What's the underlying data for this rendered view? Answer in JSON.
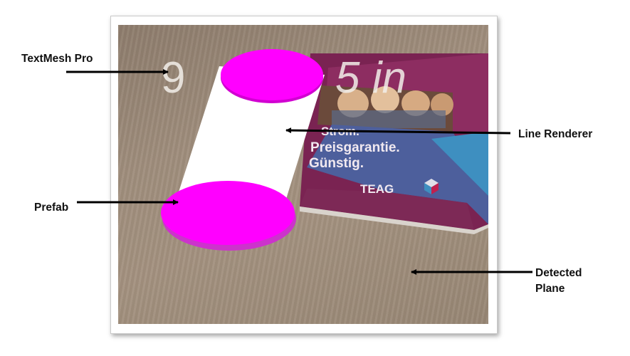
{
  "labels": {
    "textmesh": "TextMesh Pro",
    "line_renderer": "Line Renderer",
    "prefab": "Prefab",
    "detected_plane_line1": "Detected",
    "detected_plane_line2": "Plane"
  },
  "scene": {
    "overlay_text": "9",
    "overlay_text_tail": "5 in",
    "brochure_line1": "Strom.",
    "brochure_line2": "Preisgarantie.",
    "brochure_line3": "Günstig.",
    "brochure_brand": "TEAG"
  },
  "colors": {
    "prefab": "#ff00ff",
    "line_renderer": "#ffffff",
    "brochure": "#8b2a5c",
    "floor": "#9f8d7c",
    "arrow": "#000000"
  }
}
